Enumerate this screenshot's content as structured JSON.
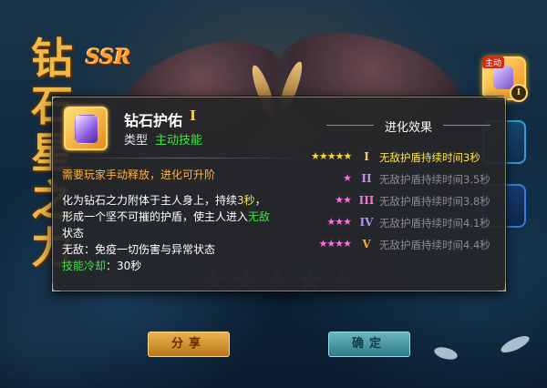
{
  "background": {
    "vertical_title": "钻石星之力",
    "rarity_badge": "SSR",
    "star_count": 5
  },
  "side_panel": {
    "active_skill_tag": "主动",
    "active_skill_level": "I"
  },
  "skill": {
    "name": "钻石护佑",
    "level_roman": "I",
    "type_label": "类型",
    "type_value": "主动技能",
    "hint": "需要玩家手动释放，进化可升阶",
    "description_line1_a": "化为钻石之力附体于主人身上，持续",
    "description_line1_b": "3秒",
    "description_line1_c": "，",
    "description_line2_a": "形成一个坚不可摧的护盾，使主人进入",
    "description_line2_b": "无敌",
    "description_line3": "状态",
    "description_line4": "无敌：免疫一切伤害与异常状态",
    "cooldown_label": "技能冷却",
    "cooldown_value": "：30秒"
  },
  "evolution": {
    "title": "进化效果",
    "levels": [
      {
        "stars": 5,
        "roman": "I",
        "effect": "无敌护盾持续时间3秒",
        "active": true
      },
      {
        "stars": 1,
        "roman": "II",
        "effect": "无敌护盾持续时间3.5秒",
        "active": false
      },
      {
        "stars": 2,
        "roman": "III",
        "effect": "无敌护盾持续时间3.8秒",
        "active": false
      },
      {
        "stars": 3,
        "roman": "IV",
        "effect": "无敌护盾持续时间4.1秒",
        "active": false
      },
      {
        "stars": 4,
        "roman": "V",
        "effect": "无敌护盾持续时间4.4秒",
        "active": false
      }
    ]
  },
  "buttons": {
    "share": "分享",
    "confirm": "确定"
  },
  "colors": {
    "gold_star": "#ffd23a",
    "pink_star": "#ff6fd8",
    "green": "#44e14a",
    "orange": "#ffb347",
    "roman_colors": [
      "#ffcc44",
      "#c58cff",
      "#ff6fd8",
      "#b88cff",
      "#ffaa22"
    ]
  }
}
